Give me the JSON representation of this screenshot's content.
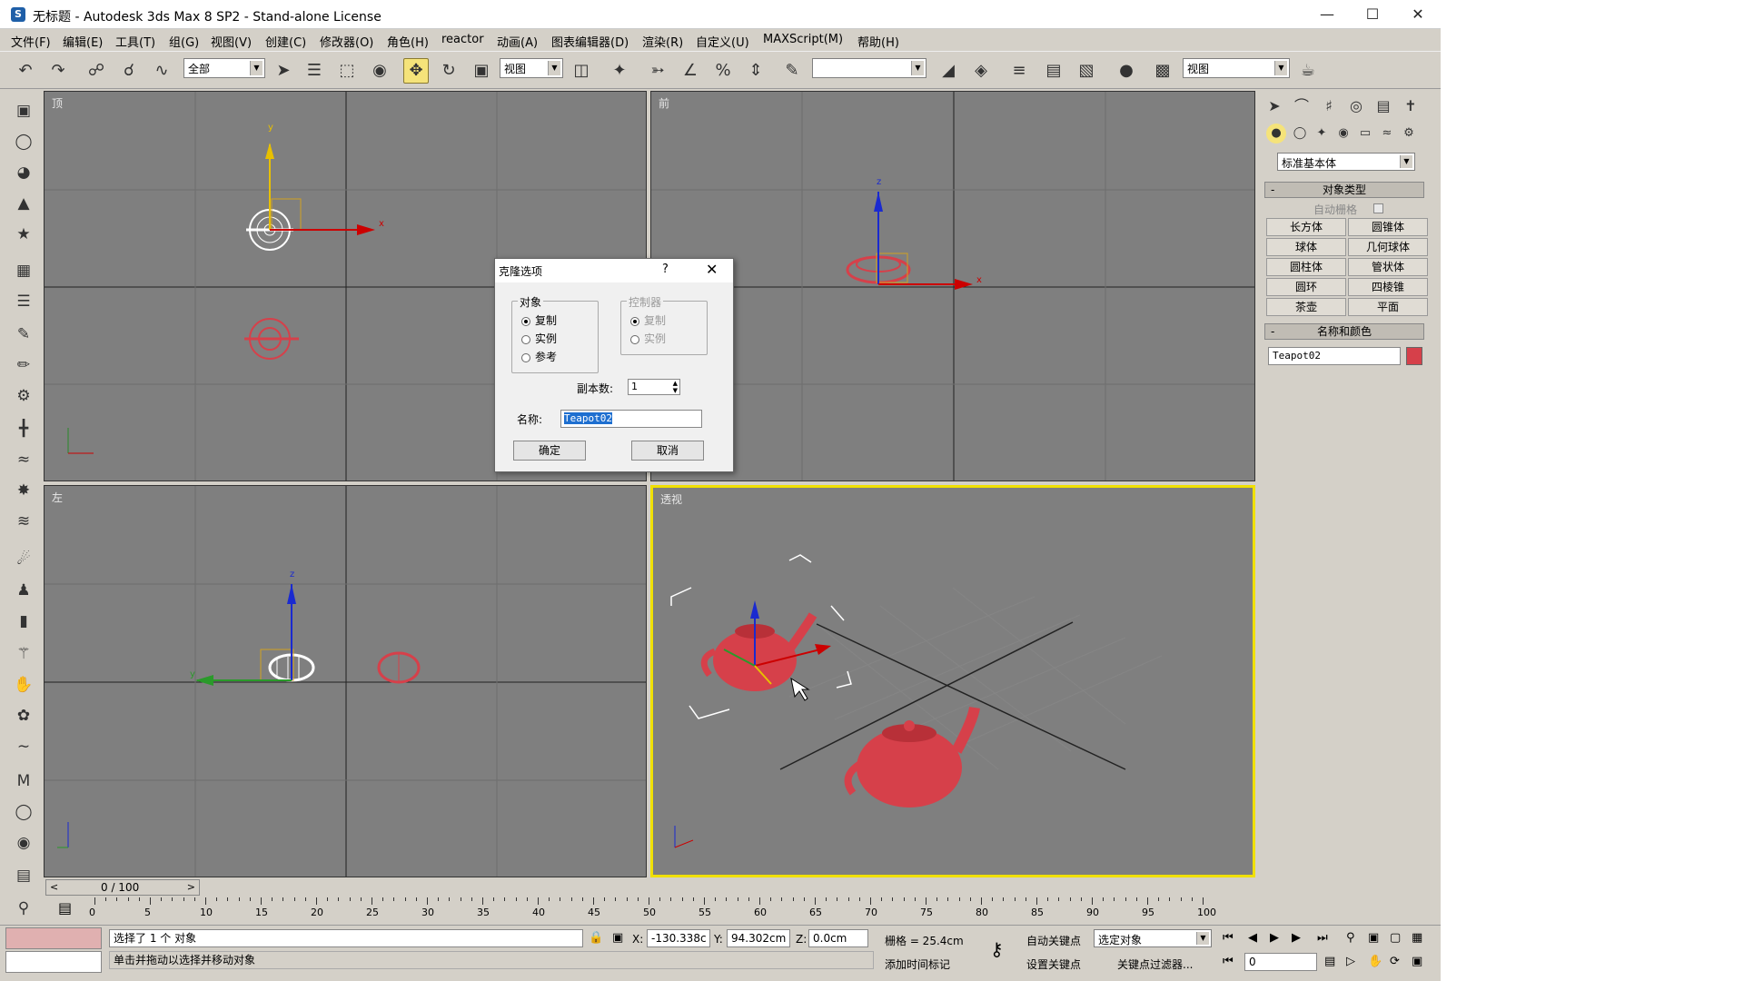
{
  "window": {
    "title": "无标题 - Autodesk 3ds Max 8 SP2  - Stand-alone License",
    "app_icon": "3ds-max-logo-icon"
  },
  "menu": [
    "文件(F)",
    "编辑(E)",
    "工具(T)",
    "组(G)",
    "视图(V)",
    "创建(C)",
    "修改器(O)",
    "角色(H)",
    "reactor",
    "动画(A)",
    "图表编辑器(D)",
    "渲染(R)",
    "自定义(U)",
    "MAXScript(M)",
    "帮助(H)"
  ],
  "toolbar": {
    "selection_filter": "全部",
    "reference_coord": "视图",
    "named_selection": "",
    "render_type": "视图",
    "icons": [
      "undo-icon",
      "redo-icon",
      "select-link-icon",
      "unlink-icon",
      "bind-space-warp-icon",
      "select-object-icon",
      "select-by-name-icon",
      "rect-selection-icon",
      "window-crossing-icon",
      "move-icon",
      "rotate-icon",
      "scale-icon",
      "pivot-center-icon",
      "select-manipulate-icon",
      "snap-toggle-icon",
      "angle-snap-icon",
      "percent-snap-icon",
      "spinner-snap-icon",
      "edit-named-selection-icon",
      "mirror-icon",
      "align-icon",
      "layer-manager-icon",
      "curve-editor-icon",
      "schematic-view-icon",
      "material-editor-icon",
      "render-scene-icon",
      "quick-render-icon"
    ]
  },
  "viewports": [
    {
      "label": "顶",
      "active": false
    },
    {
      "label": "前",
      "active": false
    },
    {
      "label": "左",
      "active": false
    },
    {
      "label": "透视",
      "active": true
    }
  ],
  "command_panel": {
    "category_dropdown": "标准基本体",
    "object_type_header": "对象类型",
    "autogrid_label": "自动栅格",
    "buttons": [
      "长方体",
      "圆锥体",
      "球体",
      "几何球体",
      "圆柱体",
      "管状体",
      "圆环",
      "四棱锥",
      "茶壶",
      "平面"
    ],
    "name_color_header": "名称和颜色",
    "object_name": "Teapot02",
    "object_color": "#d6404a"
  },
  "clone_dialog": {
    "title": "克隆选项",
    "help": "?",
    "object_group": "对象",
    "object_options": [
      "复制",
      "实例",
      "参考"
    ],
    "object_selected": 0,
    "controller_group": "控制器",
    "controller_options": [
      "复制",
      "实例"
    ],
    "copies_label": "副本数:",
    "copies_value": "1",
    "name_label": "名称:",
    "name_value": "Teapot02",
    "ok": "确定",
    "cancel": "取消"
  },
  "timeline": {
    "frame_display": "0 / 100",
    "ticks": [
      "0",
      "5",
      "10",
      "15",
      "20",
      "25",
      "30",
      "35",
      "40",
      "45",
      "50",
      "55",
      "60",
      "65",
      "70",
      "75",
      "80",
      "85",
      "90",
      "95",
      "100"
    ]
  },
  "status": {
    "selection_text": "选择了 1 个 对象",
    "prompt_text": "单击并拖动以选择并移动对象",
    "x_label": "X:",
    "x_value": "-130.338c",
    "y_label": "Y:",
    "y_value": "94.302cm",
    "z_label": "Z:",
    "z_value": "0.0cm",
    "grid_text": "栅格 = 25.4cm",
    "add_time_tag": "添加时间标记",
    "auto_key": "自动关键点",
    "set_key": "设置关键点",
    "key_mode": "选定对象",
    "key_filters": "关键点过滤器...",
    "current_frame": "0"
  },
  "colors": {
    "selected_teapot": "#d6404a",
    "active_viewport_border": "#f0e000",
    "viewport_bg": "#7f7f7f"
  }
}
